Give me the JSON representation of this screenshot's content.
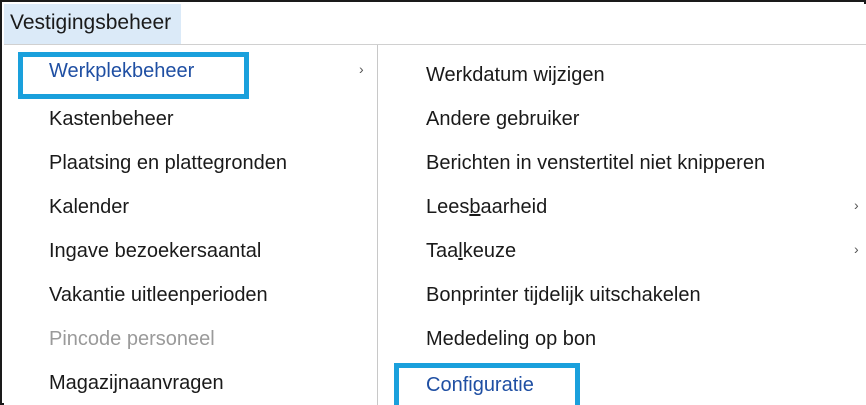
{
  "menubar": {
    "title": "Vestigingsbeheer"
  },
  "left_menu": {
    "items": [
      {
        "label": "Werkplekbeheer",
        "state": "active",
        "has_submenu": true
      },
      {
        "label": "Kastenbeheer",
        "state": "normal",
        "has_submenu": false
      },
      {
        "label": "Plaatsing en plattegronden",
        "state": "normal",
        "has_submenu": false
      },
      {
        "label": "Kalender",
        "state": "normal",
        "has_submenu": false
      },
      {
        "label": "Ingave bezoekersaantal",
        "state": "normal",
        "has_submenu": false
      },
      {
        "label": "Vakantie uitleenperioden",
        "state": "normal",
        "has_submenu": false
      },
      {
        "label": "Pincode personeel",
        "state": "disabled",
        "has_submenu": false
      },
      {
        "label": "Magazijnaanvragen",
        "state": "normal",
        "has_submenu": false
      }
    ],
    "submenu_arrow": "›"
  },
  "right_menu": {
    "items": [
      {
        "label": "Werkdatum wijzigen",
        "has_submenu": false
      },
      {
        "label": "Andere gebruiker",
        "has_submenu": false
      },
      {
        "label": "Berichten in venstertitel niet knipperen",
        "has_submenu": false
      },
      {
        "label_pre": "Lees",
        "label_accel": "b",
        "label_post": "aarheid",
        "has_submenu": true
      },
      {
        "label_pre": "Taa",
        "label_accel": "l",
        "label_post": "keuze",
        "has_submenu": true
      },
      {
        "label": "Bonprinter tijdelijk uitschakelen",
        "has_submenu": false
      },
      {
        "label": "Mededeling op bon",
        "has_submenu": false
      },
      {
        "label": "Configuratie",
        "has_submenu": false
      }
    ],
    "submenu_arrow": "›"
  },
  "colors": {
    "highlight_border": "#1aa0dc",
    "menubar_selected_bg": "#dbeaf8",
    "active_text": "#1f4fa3",
    "disabled_text": "#9a9a9a"
  }
}
